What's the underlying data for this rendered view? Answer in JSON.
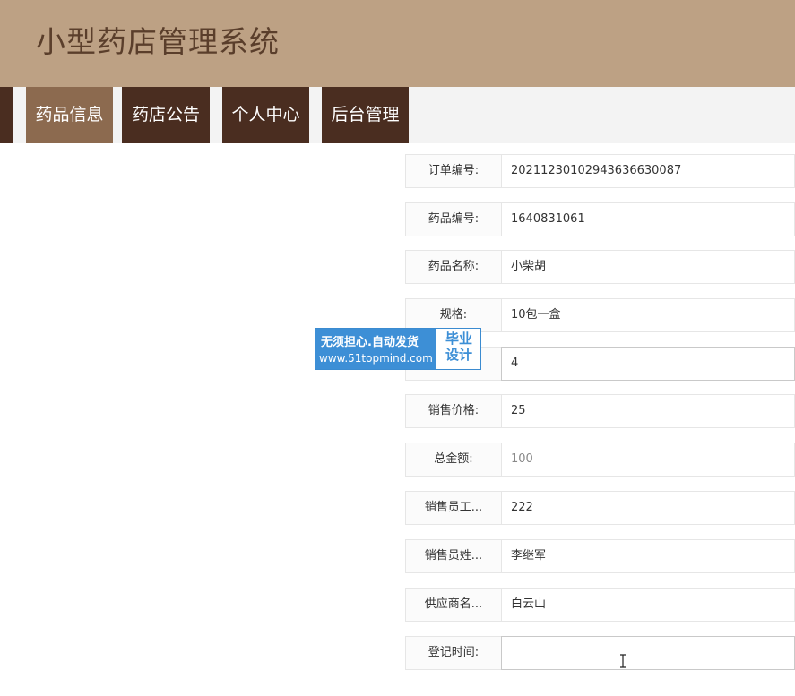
{
  "app": {
    "title": "小型药店管理系统"
  },
  "nav": {
    "items": [
      {
        "label": "药品信息",
        "active": true
      },
      {
        "label": "药店公告",
        "active": false
      },
      {
        "label": "个人中心",
        "active": false
      },
      {
        "label": "后台管理",
        "active": false
      }
    ]
  },
  "form": {
    "fields": [
      {
        "label": "订单编号:",
        "value": "20211230102943636630087"
      },
      {
        "label": "药品编号:",
        "value": "1640831061"
      },
      {
        "label": "药品名称:",
        "value": "小柴胡"
      },
      {
        "label": "规格:",
        "value": "10包一盒"
      },
      {
        "label": "",
        "value": "4"
      },
      {
        "label": "销售价格:",
        "value": "25"
      },
      {
        "label": "总金额:",
        "value": "100"
      },
      {
        "label": "销售员工...",
        "value": "222"
      },
      {
        "label": "销售员姓...",
        "value": "李继军"
      },
      {
        "label": "供应商名...",
        "value": "白云山"
      },
      {
        "label": "登记时间:",
        "value": ""
      }
    ]
  },
  "watermark": {
    "line1": "无须担心.自动发货",
    "line2": "www.51topmind.com",
    "right_top": "毕业",
    "right_bottom": "设计"
  },
  "colors": {
    "header_bg": "#bda184",
    "nav_bg": "#4a2d20",
    "nav_active_bg": "#8c6a4f",
    "watermark_blue": "#3d8fd6"
  }
}
